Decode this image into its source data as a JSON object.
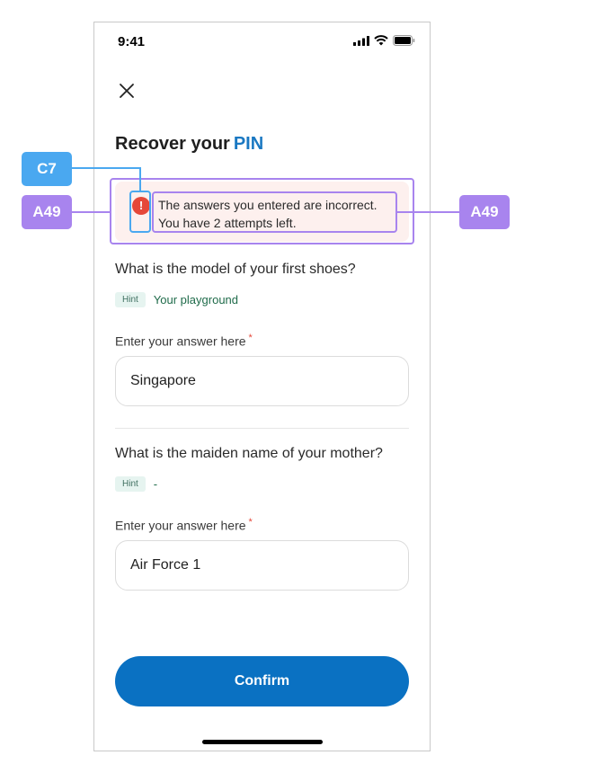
{
  "status": {
    "time": "9:41"
  },
  "icons": {
    "close": "close-icon",
    "error": "exclamation-icon",
    "signal": "signal-icon",
    "wifi": "wifi-icon",
    "battery": "battery-icon"
  },
  "title": {
    "text": "Recover your",
    "accent": "PIN"
  },
  "error": {
    "line1": "The answers you entered are incorrect.",
    "line2": "You have 2 attempts left."
  },
  "questions": [
    {
      "question": "What is the model of your first shoes?",
      "hint_label": "Hint",
      "hint": "Your playground",
      "field_label": "Enter your answer here",
      "required_mark": "*",
      "value": "Singapore"
    },
    {
      "question": "What is the maiden name of your mother?",
      "hint_label": "Hint",
      "hint": "-",
      "field_label": "Enter your answer here",
      "required_mark": "*",
      "value": "Air Force 1"
    }
  ],
  "confirm_label": "Confirm",
  "annotations": {
    "icon_tag": "C7",
    "text_tag": "A49",
    "box_tag": "A49"
  },
  "colors": {
    "accent": "#1a78c2",
    "button": "#0a71c2",
    "error": "#e5483a",
    "error_bg": "#fdf0ee",
    "annotation_blue": "#4aa8f0",
    "annotation_purple": "#a884ee"
  }
}
